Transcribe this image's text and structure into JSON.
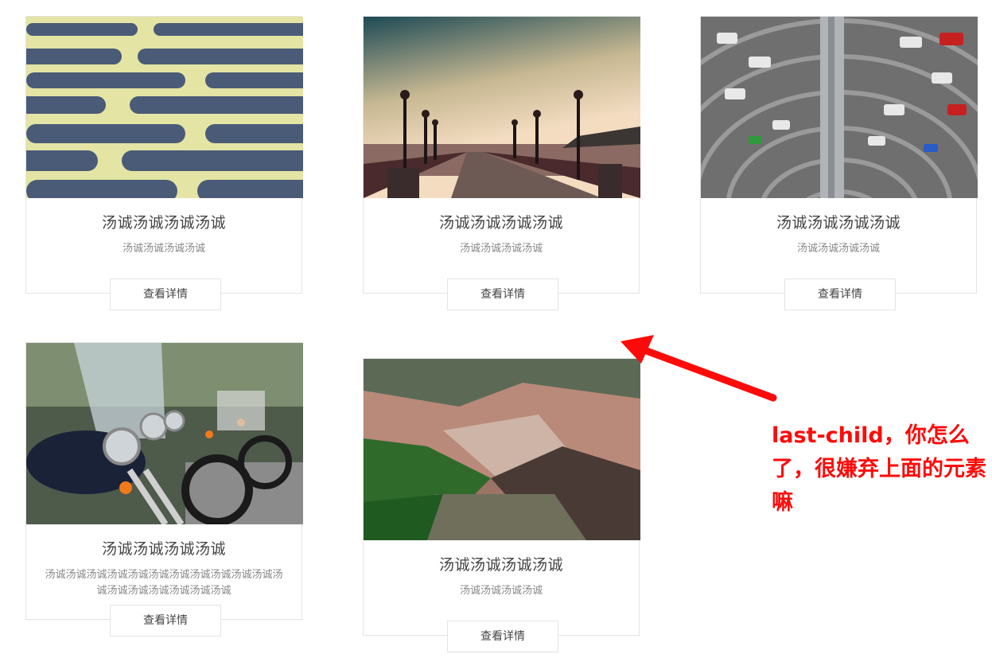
{
  "cards": [
    {
      "title": "汤诚汤诚汤诚汤诚",
      "desc": "汤诚汤诚汤诚汤诚",
      "button": "查看详情",
      "image": "metal-grate-photo"
    },
    {
      "title": "汤诚汤诚汤诚汤诚",
      "desc": "汤诚汤诚汤诚汤诚",
      "button": "查看详情",
      "image": "pier-lamps-sunset-photo"
    },
    {
      "title": "汤诚汤诚汤诚汤诚",
      "desc": "汤诚汤诚汤诚汤诚",
      "button": "查看详情",
      "image": "car-parking-tower-photo"
    },
    {
      "title": "汤诚汤诚汤诚汤诚",
      "desc": "汤诚汤诚汤诚汤诚汤诚汤诚汤诚汤诚汤诚汤诚汤诚汤诚汤诚汤诚汤诚汤诚汤诚汤诚",
      "button": "查看详情",
      "image": "motorcycles-row-photo"
    },
    {
      "title": "汤诚汤诚汤诚汤诚",
      "desc": "汤诚汤诚汤诚汤诚",
      "button": "查看详情",
      "image": "mountain-gorge-photo"
    }
  ],
  "annotation": {
    "text": "last-child，你怎么了，很嫌弃上面的元素嘛",
    "color": "#ff0a0a"
  }
}
